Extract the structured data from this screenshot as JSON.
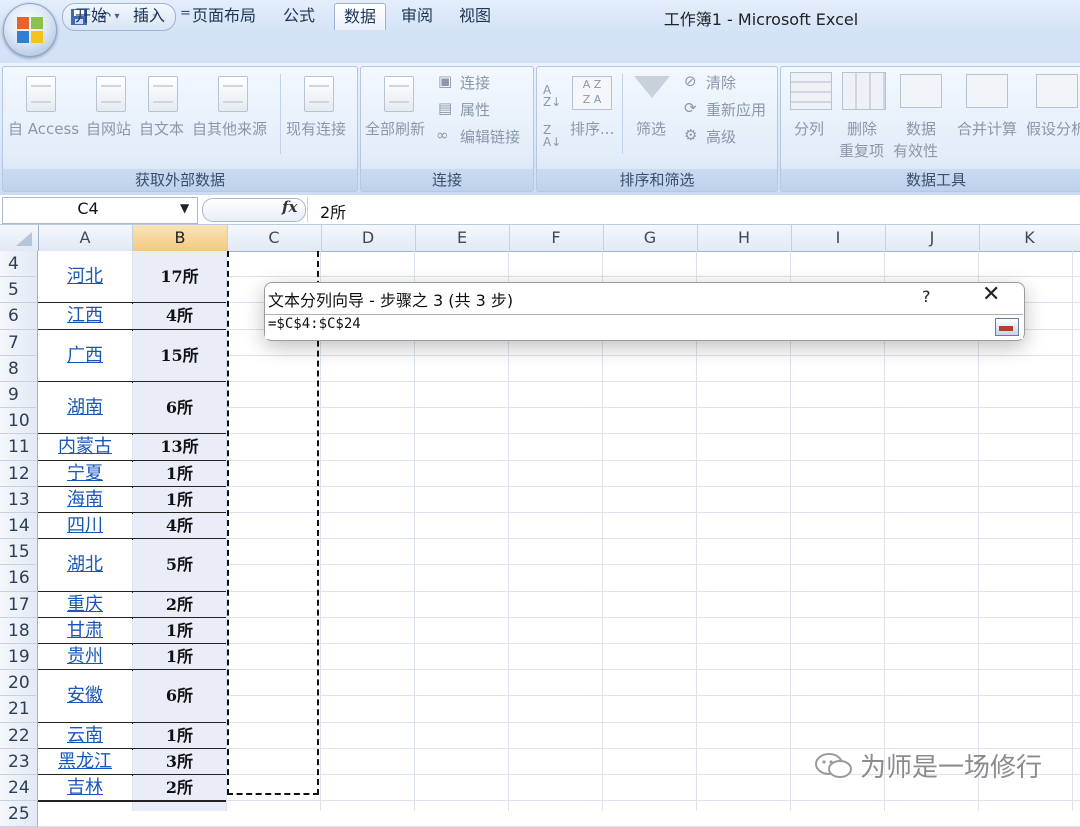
{
  "window": {
    "title": "工作簿1 - Microsoft Excel"
  },
  "quick_access": {
    "customize_label": "="
  },
  "ribbon_tabs": [
    {
      "label": "开始",
      "active": false
    },
    {
      "label": "插入",
      "active": false
    },
    {
      "label": "页面布局",
      "active": false
    },
    {
      "label": "公式",
      "active": false
    },
    {
      "label": "数据",
      "active": true
    },
    {
      "label": "审阅",
      "active": false
    },
    {
      "label": "视图",
      "active": false
    }
  ],
  "ribbon_groups": {
    "external_data": {
      "label": "获取外部数据",
      "buttons": [
        "自 Access",
        "自网站",
        "自文本",
        "自其他来源",
        "现有连接"
      ]
    },
    "connections": {
      "label": "连接",
      "refresh_all": "全部刷新",
      "small_buttons": [
        "连接",
        "属性",
        "编辑链接"
      ]
    },
    "sort_filter": {
      "label": "排序和筛选",
      "sort": "排序...",
      "filter": "筛选",
      "small_buttons": [
        "清除",
        "重新应用",
        "高级"
      ]
    },
    "data_tools": {
      "label": "数据工具",
      "split": "分列",
      "remove_dup_1": "删除",
      "remove_dup_2": "重复项",
      "validation_1": "数据",
      "validation_2": "有效性",
      "consolidate": "合并计算",
      "what_if": "假设分析"
    }
  },
  "formula_bar": {
    "name_box": "C4",
    "fx": "fx",
    "formula": "2所"
  },
  "columns": [
    "A",
    "B",
    "C",
    "D",
    "E",
    "F",
    "G",
    "H",
    "I",
    "J",
    "K"
  ],
  "selected_column": "B",
  "rows": [
    "4",
    "5",
    "6",
    "7",
    "8",
    "9",
    "10",
    "11",
    "12",
    "13",
    "14",
    "15",
    "16",
    "17",
    "18",
    "19",
    "20",
    "21",
    "22",
    "23",
    "24",
    "25"
  ],
  "records": [
    {
      "province": "河北",
      "count": "17所"
    },
    {
      "province": "江西",
      "count": "4所"
    },
    {
      "province": "广西",
      "count": "15所"
    },
    {
      "province": "湖南",
      "count": "6所"
    },
    {
      "province": "内蒙古",
      "count": "13所"
    },
    {
      "province": "宁夏",
      "count": "1所"
    },
    {
      "province": "海南",
      "count": "1所"
    },
    {
      "province": "四川",
      "count": "4所"
    },
    {
      "province": "湖北",
      "count": "5所"
    },
    {
      "province": "重庆",
      "count": "2所"
    },
    {
      "province": "甘肃",
      "count": "1所"
    },
    {
      "province": "贵州",
      "count": "1所"
    },
    {
      "province": "安徽",
      "count": "6所"
    },
    {
      "province": "云南",
      "count": "1所"
    },
    {
      "province": "黑龙江",
      "count": "3所"
    },
    {
      "province": "吉林",
      "count": "2所"
    }
  ],
  "dialog": {
    "title": "文本分列向导 - 步骤之 3 (共 3 步)",
    "help": "?",
    "close": "✕",
    "range": "=$C$4:$C$24"
  },
  "watermark": {
    "text": "为师是一场修行"
  }
}
